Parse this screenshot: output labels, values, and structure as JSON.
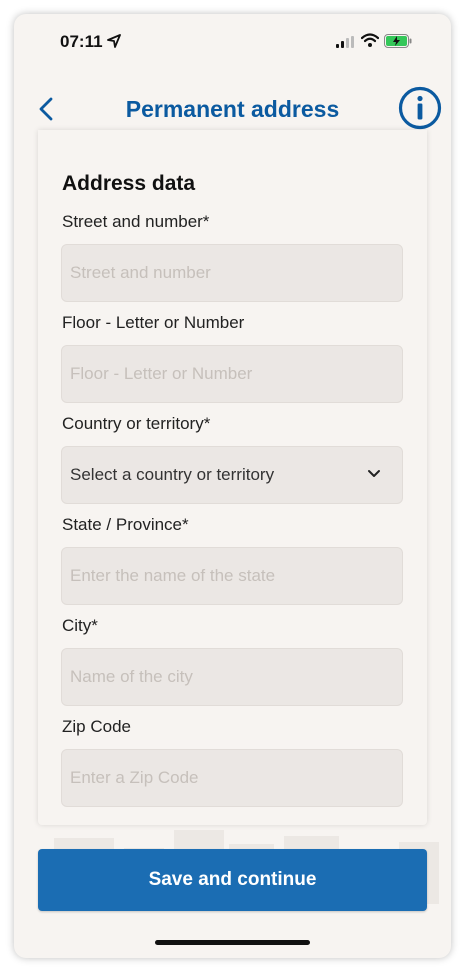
{
  "status_bar": {
    "time": "07:11"
  },
  "header": {
    "title": "Permanent address"
  },
  "form": {
    "section_title": "Address data",
    "fields": [
      {
        "label": "Street and number*",
        "placeholder": "Street and number",
        "value": ""
      },
      {
        "label": "Floor - Letter or Number",
        "placeholder": "Floor - Letter or Number",
        "value": ""
      },
      {
        "label": "Country or territory*",
        "placeholder": "Select a country or territory",
        "value": ""
      },
      {
        "label": "State / Province*",
        "placeholder": "Enter the name of the state",
        "value": ""
      },
      {
        "label": "City*",
        "placeholder": "Name of the city",
        "value": ""
      },
      {
        "label": "Zip Code",
        "placeholder": "Enter a Zip Code",
        "value": ""
      }
    ]
  },
  "footer": {
    "save_label": "Save and continue"
  },
  "colors": {
    "brand_blue": "#0b5aa0",
    "button_blue": "#1b6db3",
    "background": "#f7f4f1",
    "field_bg": "#ebe7e4",
    "battery_green": "#34c759"
  },
  "icons": [
    "location-arrow-icon",
    "signal-icon",
    "wifi-icon",
    "battery-charging-icon",
    "back-chevron-icon",
    "info-icon",
    "chevron-down-icon"
  ]
}
